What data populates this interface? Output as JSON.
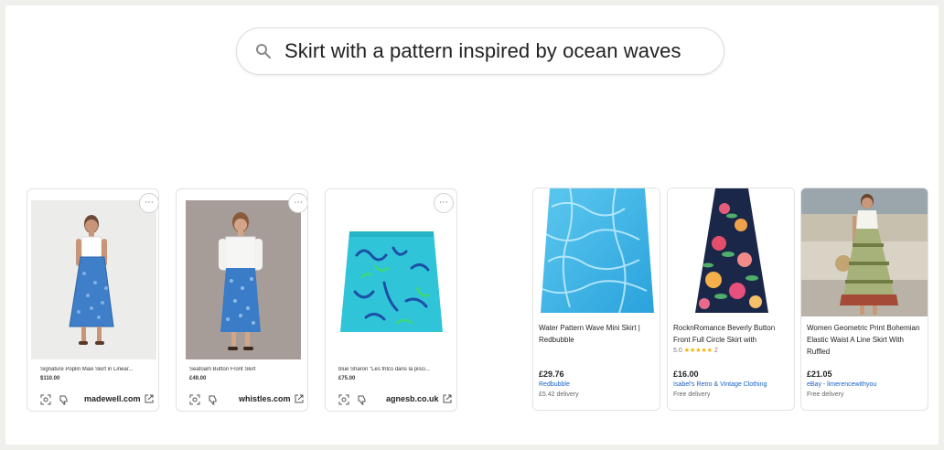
{
  "search": {
    "query": "Skirt with a pattern inspired by ocean waves"
  },
  "left_cards": [
    {
      "title": "Signature Poplin Maxi Skirt in Linear...",
      "price": "$110.00",
      "store": "madewell.com"
    },
    {
      "title": "Seafoam Button Front Skirt",
      "price": "£49.00",
      "store": "whistles.com"
    },
    {
      "title": "blue Sharon \"Les fritcs dans la pisci...",
      "price": "£75.00",
      "store": "agnesb.co.uk"
    }
  ],
  "right_cards": [
    {
      "title": "Water Pattern Wave Mini Skirt | Redbubble",
      "price": "£29.76",
      "seller": "Redbubble",
      "delivery": "£5.42 delivery"
    },
    {
      "title": "RocknRomance Beverly Button Front Full Circle Skirt with",
      "rating": "5.0",
      "stars": "★★★★★",
      "reviews": "2",
      "price": "£16.00",
      "seller": "Isabel's Retro & Vintage Clothing",
      "delivery": "Free delivery"
    },
    {
      "title": "Women Geometric Print Bohemian Elastic Waist A Line Skirt With Ruffled",
      "price": "£21.05",
      "seller": "eBay - limerencewithyou",
      "delivery": "Free delivery"
    }
  ],
  "icons": {
    "search": "search-icon",
    "more": "more-options-icon",
    "lens": "lens-icon",
    "dislike": "thumbs-down-icon",
    "external": "external-link-icon"
  },
  "colors": {
    "link": "#1a61c5",
    "stars": "#f1b000",
    "page": "#efefeb"
  }
}
